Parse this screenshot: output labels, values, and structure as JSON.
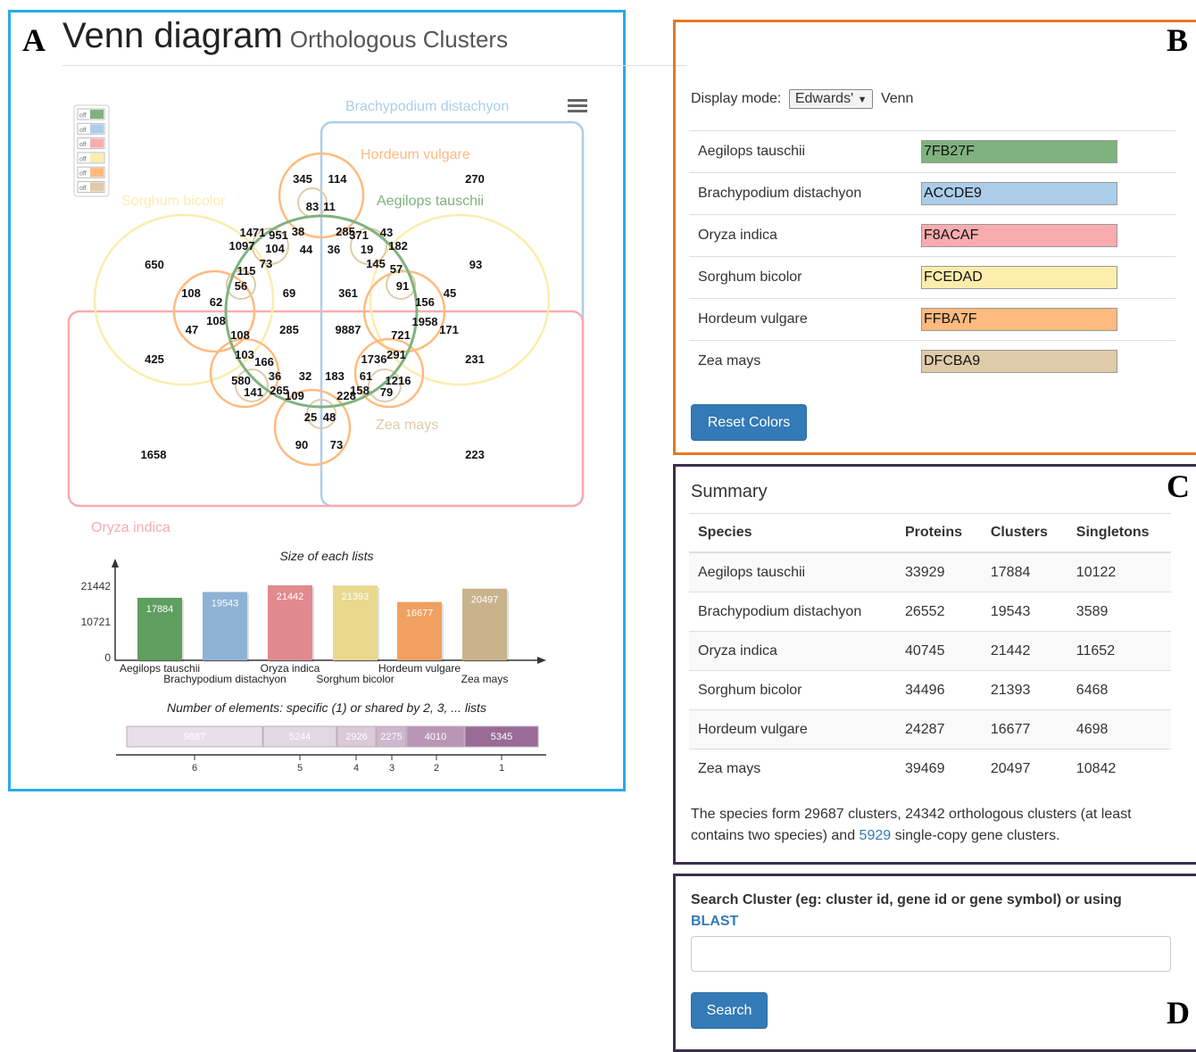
{
  "panel_letters": {
    "a": "A",
    "b": "B",
    "c": "C",
    "d": "D"
  },
  "venn": {
    "title": "Venn diagram",
    "subtitle": "Orthologous Clusters",
    "menu_icon": "hamburger-menu-icon",
    "legend_toggle_label": "off",
    "sets": {
      "brachypodium": {
        "label": "Brachypodium distachyon",
        "color": "#ACCDE9"
      },
      "hordeum": {
        "label": "Hordeum vulgare",
        "color": "#FFBA7F"
      },
      "aegilops": {
        "label": "Aegilops tauschii",
        "color": "#7FB27F"
      },
      "sorghum": {
        "label": "Sorghum bicolor",
        "color": "#FCEDAD"
      },
      "zea": {
        "label": "Zea mays",
        "color": "#DFCBA9"
      },
      "oryza": {
        "label": "Oryza indica",
        "color": "#F8ACAF"
      }
    },
    "numbers": [
      "345",
      "114",
      "270",
      "83",
      "11",
      "1471",
      "951",
      "38",
      "285",
      "371",
      "43",
      "1097",
      "104",
      "44",
      "36",
      "19",
      "182",
      "650",
      "73",
      "145",
      "57",
      "93",
      "115",
      "56",
      "91",
      "108",
      "62",
      "69",
      "361",
      "45",
      "156",
      "108",
      "1958",
      "47",
      "108",
      "285",
      "9887",
      "721",
      "171",
      "103",
      "166",
      "1736",
      "291",
      "425",
      "231",
      "580",
      "36",
      "32",
      "183",
      "61",
      "1216",
      "141",
      "265",
      "109",
      "228",
      "158",
      "79",
      "25",
      "48",
      "90",
      "73",
      "1658",
      "223"
    ]
  },
  "chart_data": [
    {
      "type": "bar",
      "title": "Size of each lists",
      "categories": [
        "Aegilops tauschii",
        "Brachypodium distachyon",
        "Oryza indica",
        "Sorghum bicolor",
        "Hordeum vulgare",
        "Zea mays"
      ],
      "values": [
        17884,
        19543,
        21442,
        21393,
        16677,
        20497
      ],
      "colors": [
        "#5f9e5f",
        "#8eb2d6",
        "#e08a8e",
        "#e8d98f",
        "#f0a060",
        "#c9b38c"
      ],
      "yticks": [
        "21442",
        "10721",
        "0"
      ],
      "ylim": [
        0,
        21442
      ]
    },
    {
      "type": "bar",
      "title": "Number of elements: specific (1) or shared by 2, 3, ... lists",
      "categories": [
        "6",
        "5",
        "4",
        "3",
        "2",
        "1"
      ],
      "values": [
        9887,
        5244,
        2926,
        2275,
        4010,
        5345
      ],
      "colors": [
        "#e9dfe8",
        "#e2d6e2",
        "#d9c9d9",
        "#cdb7cc",
        "#b996b6",
        "#9a6b96"
      ]
    }
  ],
  "display": {
    "label": "Display mode:",
    "mode": "Edwards'",
    "suffix": "Venn",
    "rows": [
      {
        "species": "Aegilops tauschii",
        "hex": "7FB27F",
        "color": "#7FB27F"
      },
      {
        "species": "Brachypodium distachyon",
        "hex": "ACCDE9",
        "color": "#ACCDE9"
      },
      {
        "species": "Oryza indica",
        "hex": "F8ACAF",
        "color": "#F8ACAF"
      },
      {
        "species": "Sorghum bicolor",
        "hex": "FCEDAD",
        "color": "#FCEDAD"
      },
      {
        "species": "Hordeum vulgare",
        "hex": "FFBA7F",
        "color": "#FFBA7F"
      },
      {
        "species": "Zea mays",
        "hex": "DFCBA9",
        "color": "#DFCBA9"
      }
    ],
    "reset_label": "Reset Colors"
  },
  "summary": {
    "title": "Summary",
    "headers": [
      "Species",
      "Proteins",
      "Clusters",
      "Singletons"
    ],
    "rows": [
      [
        "Aegilops tauschii",
        "33929",
        "17884",
        "10122"
      ],
      [
        "Brachypodium distachyon",
        "26552",
        "19543",
        "3589"
      ],
      [
        "Oryza indica",
        "40745",
        "21442",
        "11652"
      ],
      [
        "Sorghum bicolor",
        "34496",
        "21393",
        "6468"
      ],
      [
        "Hordeum vulgare",
        "24287",
        "16677",
        "4698"
      ],
      [
        "Zea mays",
        "39469",
        "20497",
        "10842"
      ]
    ],
    "text_before": "The species form 29687 clusters, 24342 orthologous clusters (at least contains two species) and ",
    "text_link": "5929",
    "text_after": " single-copy gene clusters."
  },
  "search": {
    "label": "Search Cluster (eg: cluster id, gene id or gene symbol) or using",
    "blast_link": "BLAST",
    "placeholder": "",
    "button": "Search"
  }
}
